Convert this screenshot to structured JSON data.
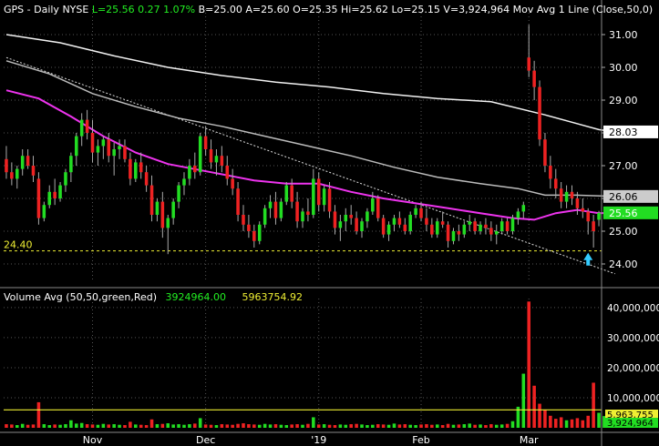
{
  "header": {
    "symbol": "GPS - Daily",
    "exchange": "NYSE",
    "last": "L=25.56",
    "change": "0.27",
    "change_pct": "1.07%",
    "bid": "B=25.00",
    "ask": "A=25.60",
    "open": "O=25.35",
    "high": "Hi=25.62",
    "low": "Lo=25.15",
    "volume": "V=3,924,964",
    "indicator": "Mov Avg 1 Line (Close,50,0)"
  },
  "volume_header": {
    "label": "Volume Avg (50,50,green,Red)",
    "value1": "3924964.00",
    "value2": "5963754.92"
  },
  "colors": {
    "background": "#000000",
    "up": "#22dd22",
    "down": "#ee2222",
    "ma50": "#ee33ee",
    "ma_gray": "#bbbbbb",
    "ma_white": "#f2f2f2",
    "volume_avg": "#eeee33",
    "support": "#eeee33",
    "arrow": "#33ccff",
    "grid": "#555555"
  },
  "chart_data": {
    "type": "candlestick",
    "price_axis": {
      "ylim": [
        23.5,
        31.5
      ],
      "ticks": [
        24,
        25,
        26,
        27,
        28,
        29,
        30,
        31
      ]
    },
    "volume_axis": {
      "ylim": [
        0,
        43000000
      ],
      "ticks": [
        "10,000,000",
        "20,000,000",
        "30,000,000",
        "40,000,000"
      ],
      "tick_values": [
        10000000,
        20000000,
        30000000,
        40000000
      ]
    },
    "x_labels": [
      "Nov",
      "Dec",
      "'19",
      "Feb",
      "Mar"
    ],
    "x_label_index": [
      16,
      37,
      58,
      77,
      97
    ],
    "price_tags": [
      {
        "text": "28.03",
        "value": 28.03,
        "style": "white"
      },
      {
        "text": "26.06",
        "value": 26.06,
        "style": "gray"
      },
      {
        "text": "25.56",
        "value": 25.56,
        "style": "green"
      }
    ],
    "support_level": {
      "text": "24.40",
      "value": 24.4
    },
    "volume_tags": [
      {
        "text": "5,963,755",
        "value": 5963755,
        "style": "yellow"
      },
      {
        "text": "3,924,964",
        "value": 3924964,
        "style": "green"
      }
    ],
    "arrow_index": 108,
    "trendline": {
      "from": [
        0,
        30.3
      ],
      "to": [
        113,
        23.7
      ]
    },
    "candles": [
      [
        27.2,
        27.6,
        26.6,
        26.8
      ],
      [
        26.8,
        27.1,
        26.4,
        26.6
      ],
      [
        26.6,
        27.0,
        26.3,
        26.9
      ],
      [
        26.9,
        27.5,
        26.7,
        27.3
      ],
      [
        27.3,
        27.5,
        26.9,
        27.0
      ],
      [
        27.0,
        27.3,
        26.5,
        26.7
      ],
      [
        26.6,
        26.8,
        25.2,
        25.4
      ],
      [
        25.4,
        25.9,
        25.3,
        25.8
      ],
      [
        25.8,
        26.4,
        25.7,
        26.2
      ],
      [
        26.2,
        26.6,
        25.8,
        26.0
      ],
      [
        26.0,
        26.5,
        25.9,
        26.4
      ],
      [
        26.4,
        26.9,
        26.2,
        26.8
      ],
      [
        26.8,
        27.4,
        26.5,
        27.3
      ],
      [
        27.3,
        28.0,
        27.0,
        27.9
      ],
      [
        27.9,
        28.6,
        27.6,
        28.4
      ],
      [
        28.4,
        28.7,
        27.8,
        28.0
      ],
      [
        28.0,
        28.4,
        27.1,
        27.4
      ],
      [
        27.4,
        27.8,
        27.0,
        27.6
      ],
      [
        27.6,
        27.9,
        27.2,
        27.8
      ],
      [
        27.8,
        28.0,
        27.1,
        27.3
      ],
      [
        27.3,
        27.7,
        26.7,
        27.5
      ],
      [
        27.5,
        27.8,
        27.2,
        27.6
      ],
      [
        27.6,
        27.8,
        27.1,
        27.2
      ],
      [
        27.2,
        27.4,
        26.4,
        26.6
      ],
      [
        26.6,
        27.2,
        26.5,
        27.1
      ],
      [
        27.1,
        27.4,
        26.6,
        26.8
      ],
      [
        26.8,
        27.0,
        26.2,
        26.4
      ],
      [
        26.4,
        26.7,
        25.3,
        25.5
      ],
      [
        25.5,
        26.0,
        25.3,
        25.9
      ],
      [
        25.9,
        26.2,
        24.8,
        25.1
      ],
      [
        25.1,
        25.5,
        24.3,
        25.4
      ],
      [
        25.4,
        26.0,
        25.2,
        25.9
      ],
      [
        25.9,
        26.5,
        25.7,
        26.4
      ],
      [
        26.4,
        26.8,
        26.1,
        26.6
      ],
      [
        26.6,
        27.2,
        26.4,
        27.0
      ],
      [
        27.0,
        27.4,
        26.6,
        26.8
      ],
      [
        26.8,
        28.0,
        26.7,
        27.9
      ],
      [
        27.9,
        28.2,
        27.3,
        27.5
      ],
      [
        27.5,
        27.8,
        26.9,
        27.1
      ],
      [
        27.1,
        27.5,
        26.7,
        27.3
      ],
      [
        27.3,
        27.6,
        26.8,
        27.0
      ],
      [
        27.0,
        27.3,
        26.4,
        26.6
      ],
      [
        26.6,
        26.9,
        26.1,
        26.3
      ],
      [
        26.3,
        26.5,
        25.3,
        25.5
      ],
      [
        25.5,
        25.8,
        25.0,
        25.2
      ],
      [
        25.2,
        25.5,
        24.8,
        25.0
      ],
      [
        25.0,
        25.2,
        24.5,
        24.7
      ],
      [
        24.7,
        25.3,
        24.6,
        25.2
      ],
      [
        25.2,
        25.8,
        25.1,
        25.7
      ],
      [
        25.7,
        26.1,
        25.4,
        25.9
      ],
      [
        25.9,
        26.2,
        25.2,
        25.4
      ],
      [
        25.4,
        26.0,
        25.3,
        25.9
      ],
      [
        25.9,
        26.5,
        25.8,
        26.4
      ],
      [
        26.4,
        26.6,
        25.7,
        25.9
      ],
      [
        25.9,
        26.2,
        25.1,
        25.3
      ],
      [
        25.3,
        25.7,
        25.1,
        25.6
      ],
      [
        25.6,
        26.0,
        25.3,
        25.5
      ],
      [
        25.5,
        26.9,
        25.4,
        26.6
      ],
      [
        26.6,
        26.8,
        25.6,
        25.8
      ],
      [
        25.8,
        26.4,
        25.6,
        26.3
      ],
      [
        26.3,
        26.5,
        25.4,
        25.6
      ],
      [
        25.6,
        25.8,
        24.9,
        25.1
      ],
      [
        25.1,
        25.5,
        24.7,
        25.3
      ],
      [
        25.3,
        25.7,
        25.0,
        25.5
      ],
      [
        25.5,
        25.8,
        25.2,
        25.4
      ],
      [
        25.4,
        25.6,
        24.9,
        25.0
      ],
      [
        25.0,
        25.4,
        24.8,
        25.3
      ],
      [
        25.3,
        25.7,
        25.1,
        25.6
      ],
      [
        25.6,
        26.2,
        25.5,
        26.0
      ],
      [
        26.0,
        26.1,
        25.3,
        25.4
      ],
      [
        25.4,
        25.5,
        24.8,
        24.9
      ],
      [
        24.9,
        25.3,
        24.7,
        25.2
      ],
      [
        25.2,
        25.5,
        25.0,
        25.4
      ],
      [
        25.4,
        25.6,
        25.1,
        25.2
      ],
      [
        25.2,
        25.4,
        24.9,
        25.0
      ],
      [
        25.0,
        25.6,
        24.9,
        25.5
      ],
      [
        25.5,
        25.8,
        25.4,
        25.7
      ],
      [
        25.7,
        25.9,
        25.3,
        25.4
      ],
      [
        25.4,
        25.7,
        25.0,
        25.2
      ],
      [
        25.2,
        25.4,
        24.8,
        24.9
      ],
      [
        24.9,
        25.4,
        24.8,
        25.3
      ],
      [
        25.3,
        25.6,
        25.1,
        25.2
      ],
      [
        25.2,
        25.3,
        24.5,
        24.7
      ],
      [
        24.7,
        25.1,
        24.6,
        25.0
      ],
      [
        25.0,
        25.2,
        24.7,
        24.9
      ],
      [
        24.9,
        25.3,
        24.8,
        25.2
      ],
      [
        25.2,
        25.5,
        25.0,
        25.3
      ],
      [
        25.3,
        25.4,
        24.9,
        25.0
      ],
      [
        25.0,
        25.3,
        24.9,
        25.2
      ],
      [
        25.2,
        25.4,
        24.9,
        25.1
      ],
      [
        25.1,
        25.3,
        24.7,
        24.9
      ],
      [
        24.9,
        25.2,
        24.6,
        25.0
      ],
      [
        25.0,
        25.4,
        24.9,
        25.3
      ],
      [
        25.3,
        25.4,
        24.9,
        25.0
      ],
      [
        25.0,
        25.5,
        24.9,
        25.4
      ],
      [
        25.4,
        25.7,
        25.2,
        25.6
      ],
      [
        25.6,
        25.9,
        25.4,
        25.8
      ],
      [
        30.3,
        31.3,
        29.7,
        29.9
      ],
      [
        29.9,
        30.2,
        29.0,
        29.4
      ],
      [
        29.4,
        29.6,
        27.6,
        27.8
      ],
      [
        27.8,
        28.0,
        26.8,
        27.0
      ],
      [
        27.0,
        27.3,
        26.3,
        26.6
      ],
      [
        26.6,
        26.9,
        26.0,
        26.3
      ],
      [
        26.3,
        26.5,
        25.7,
        25.9
      ],
      [
        25.9,
        26.4,
        25.7,
        26.2
      ],
      [
        26.2,
        26.4,
        25.8,
        26.0
      ],
      [
        26.0,
        26.2,
        25.5,
        25.7
      ],
      [
        25.7,
        26.0,
        25.4,
        25.6
      ],
      [
        25.6,
        25.7,
        24.9,
        25.3
      ],
      [
        25.3,
        25.5,
        24.5,
        25.0
      ],
      [
        25.35,
        25.62,
        25.15,
        25.56
      ]
    ],
    "ma_white": [
      [
        0,
        31.0
      ],
      [
        10,
        30.75
      ],
      [
        20,
        30.35
      ],
      [
        30,
        30.0
      ],
      [
        40,
        29.75
      ],
      [
        50,
        29.55
      ],
      [
        60,
        29.4
      ],
      [
        70,
        29.2
      ],
      [
        80,
        29.05
      ],
      [
        90,
        28.95
      ],
      [
        100,
        28.55
      ],
      [
        110,
        28.1
      ],
      [
        113,
        28.03
      ]
    ],
    "ma_gray": [
      [
        0,
        30.2
      ],
      [
        8,
        29.8
      ],
      [
        16,
        29.2
      ],
      [
        24,
        28.8
      ],
      [
        32,
        28.45
      ],
      [
        40,
        28.2
      ],
      [
        48,
        27.9
      ],
      [
        56,
        27.6
      ],
      [
        64,
        27.3
      ],
      [
        72,
        26.95
      ],
      [
        80,
        26.65
      ],
      [
        88,
        26.45
      ],
      [
        95,
        26.3
      ],
      [
        100,
        26.1
      ],
      [
        106,
        26.1
      ],
      [
        113,
        26.06
      ]
    ],
    "ma50": [
      [
        0,
        29.3
      ],
      [
        6,
        29.05
      ],
      [
        12,
        28.5
      ],
      [
        18,
        27.9
      ],
      [
        24,
        27.4
      ],
      [
        30,
        27.05
      ],
      [
        38,
        26.8
      ],
      [
        46,
        26.55
      ],
      [
        52,
        26.45
      ],
      [
        58,
        26.45
      ],
      [
        64,
        26.2
      ],
      [
        70,
        26.0
      ],
      [
        76,
        25.85
      ],
      [
        82,
        25.7
      ],
      [
        88,
        25.55
      ],
      [
        94,
        25.4
      ],
      [
        98,
        25.35
      ],
      [
        102,
        25.55
      ],
      [
        106,
        25.65
      ],
      [
        110,
        25.55
      ],
      [
        113,
        25.56
      ]
    ],
    "volume": [
      1.2,
      1.1,
      0.9,
      1.3,
      1.0,
      1.1,
      8.5,
      1.2,
      0.9,
      1.1,
      1.0,
      1.2,
      2.5,
      1.4,
      1.6,
      1.2,
      1.1,
      1.0,
      1.3,
      1.1,
      1.2,
      1.0,
      0.9,
      2.0,
      1.1,
      1.0,
      0.9,
      2.8,
      1.2,
      1.3,
      1.5,
      1.1,
      1.2,
      1.0,
      1.2,
      1.4,
      3.2,
      1.1,
      1.0,
      0.9,
      1.2,
      1.1,
      1.0,
      1.3,
      1.5,
      1.2,
      1.1,
      1.0,
      1.3,
      1.1,
      1.2,
      1.0,
      0.9,
      1.1,
      1.2,
      1.0,
      1.3,
      3.5,
      1.1,
      1.2,
      1.0,
      0.9,
      1.1,
      1.0,
      1.2,
      1.3,
      1.1,
      0.9,
      1.0,
      1.2,
      1.1,
      1.0,
      1.4,
      1.1,
      1.2,
      1.0,
      0.9,
      1.1,
      1.2,
      1.0,
      1.1,
      0.9,
      1.3,
      1.0,
      1.1,
      1.2,
      1.4,
      1.0,
      1.1,
      0.9,
      1.2,
      1.0,
      1.1,
      1.3,
      2.2,
      7.0,
      18.0,
      42.0,
      14.0,
      8.0,
      6.0,
      4.0,
      3.0,
      3.5,
      2.5,
      2.8,
      3.2,
      2.5,
      4.0,
      15.0,
      5.0,
      3.9
    ]
  }
}
